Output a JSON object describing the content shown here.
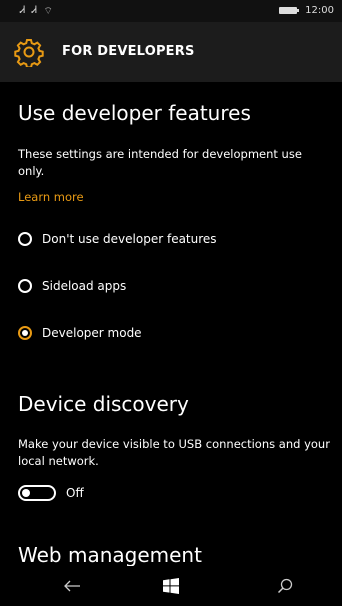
{
  "status_bar": {
    "signal_1": "Ꮧ",
    "signal_2": "Ꮧ",
    "wifi": "⌔",
    "time": "12:00"
  },
  "header": {
    "title": "FOR DEVELOPERS",
    "icon": "gear-icon",
    "accent_color": "#e89a14"
  },
  "use_developer_features": {
    "title": "Use developer features",
    "description": "These settings are intended for development use only.",
    "learn_more": "Learn more",
    "options": [
      {
        "label": "Don't use developer features",
        "selected": false
      },
      {
        "label": "Sideload apps",
        "selected": false
      },
      {
        "label": "Developer mode",
        "selected": true
      }
    ]
  },
  "device_discovery": {
    "title": "Device discovery",
    "description": "Make your device visible to USB connections and your local network.",
    "toggle_state": "Off",
    "toggle_on": false
  },
  "web_management": {
    "title": "Web management"
  },
  "nav_bar": {
    "back": "back-arrow-icon",
    "home": "windows-icon",
    "search": "search-icon"
  }
}
